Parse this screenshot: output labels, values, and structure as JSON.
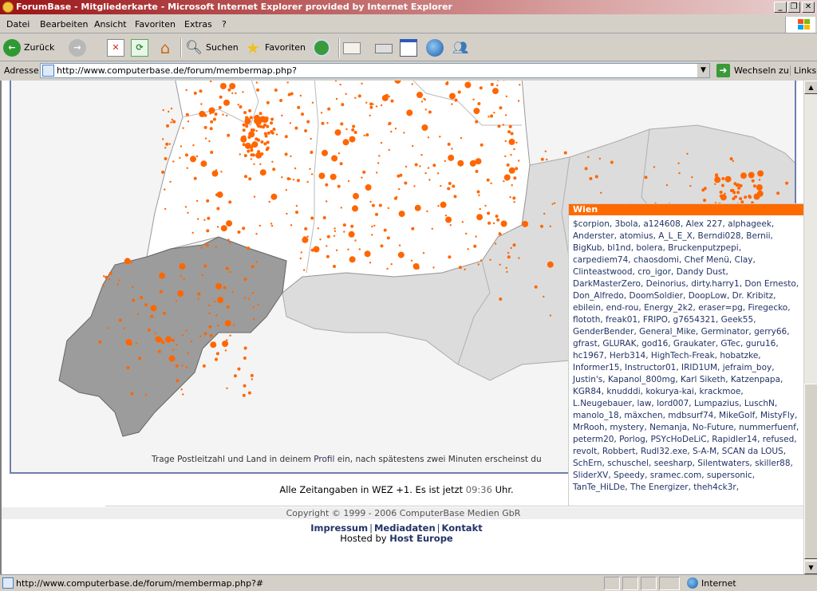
{
  "window": {
    "title": "ForumBase - Mitgliederkarte - Microsoft Internet Explorer provided by Internet Explorer",
    "controls": [
      "_",
      "❐",
      "✕"
    ]
  },
  "menu": [
    "Datei",
    "Bearbeiten",
    "Ansicht",
    "Favoriten",
    "Extras",
    "?"
  ],
  "toolbar": {
    "back_label": "Zurück",
    "search_label": "Suchen",
    "favorites_label": "Favoriten",
    "icons": [
      "back-icon",
      "forward-icon",
      "stop-icon",
      "refresh-icon",
      "home-icon",
      "search-icon",
      "favorites-star-icon",
      "history-icon",
      "mail-icon",
      "print-icon",
      "edit-icon",
      "messenger-icon",
      "discuss-icon"
    ]
  },
  "address": {
    "label": "Adresse",
    "url": "http://www.computerbase.de/forum/membermap.php?",
    "go_label": "Wechseln zu",
    "links_label": "Links"
  },
  "map": {
    "hint_prefix": "Trage Postleitzahl und Land in deinem ",
    "hint_link": "Profil",
    "hint_suffix": " ein, nach spätestens zwei Minuten erscheinst du",
    "accent_color": "#ff6600",
    "switzerland_color": "#999999",
    "austria_color": "#d9d9d9",
    "germany_color": "#ffffff"
  },
  "tooltip": {
    "city": "Wien",
    "names": "$corpion, 3bola, a124608, Alex 227, alphageek, Anderster, atomius, A_L_E_X, Berndi028, Bernii, BigKub, bl1nd, bolera, Bruckenputzpepi, carpediem74, chaosdomi, Chef Menü, Clay, Clinteastwood, cro_igor, Dandy Dust, DarkMasterZero, Deinorius, dirty.harry1, Don Ernesto, Don_Alfredo, DoomSoldier, DoopLow, Dr. Kribitz, ebilein, end-rou, Energy_2k2, eraser=pg, Firegecko, flototh, freak01, FRIPO, g7654321, Geek55, GenderBender, General_Mike, Germinator, gerry66, gfrast, GLURAK, god16, Graukater, GTec, guru16, hc1967, Herb314, HighTech-Freak, hobatzke, Informer15, Instructor01, IRID1UM, jefraim_boy, Justin's, Kapanol_800mg, Karl Siketh, Katzenpapa, KGR84, knudddi, kokurya-kai, krackmoe, L.Neugebauer, law, lord007, Lumpazius, LuschN, manolo_18, mäxchen, mdbsurf74, MikeGolf, MistyFly, MrRooh, mystery, Nemanja, No-Future, nummerfuenf, peterm20, Porlog, PSYcHoDeLiC, Rapidler14, refused, revolt, Robbert, Rudl32.exe, S-A-M, SCAN da LOUS, SchErn, schuschel, seesharp, Silentwaters, skiller88, SliderXV, Speedy, sramec.com, supersonic, TanTe_HiLDe, The Energizer, theh4ck3r,"
  },
  "footer": {
    "time_text": "Alle Zeitangaben in WEZ +1. Es ist jetzt ",
    "time_value": "09:36",
    "time_suffix": " Uhr.",
    "copyright": "Copyright © 1999 - 2006 ComputerBase Medien GbR",
    "links": [
      "Impressum",
      "Mediadaten",
      "Kontakt"
    ],
    "hosted_prefix": "Hosted by ",
    "hosted_link": "Host Europe"
  },
  "status": {
    "text": "http://www.computerbase.de/forum/membermap.php?#",
    "zone": "Internet"
  }
}
